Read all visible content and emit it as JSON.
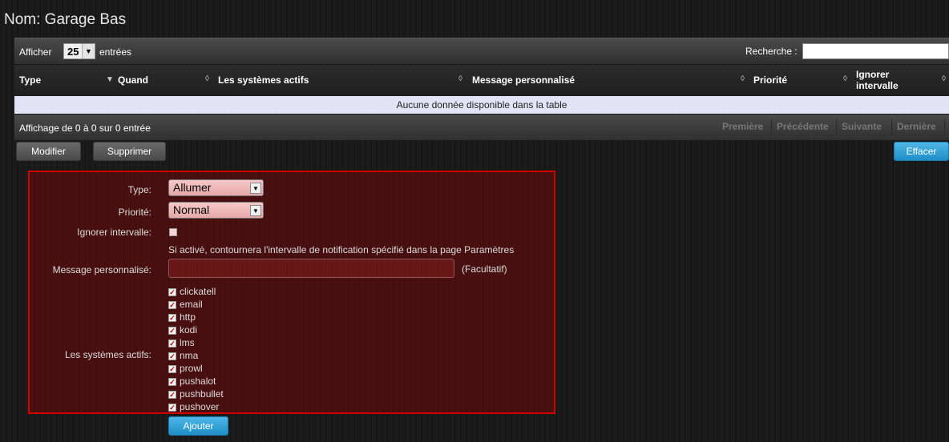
{
  "page": {
    "title": "Nom: Garage Bas"
  },
  "table_controls": {
    "show_label": "Afficher",
    "length_value": "25",
    "entries_label": "entrées",
    "search_label": "Recherche :",
    "search_value": ""
  },
  "table": {
    "columns": [
      "Type",
      "Quand",
      "Les systèmes actifs",
      "Message personnalisé",
      "Priorité",
      "Ignorer intervalle"
    ],
    "empty_message": "Aucune donnée disponible dans la table"
  },
  "info": {
    "text": "Affichage de 0 à 0 sur 0 entrée"
  },
  "pagination": [
    "Première",
    "Précédente",
    "Suivante",
    "Dernière"
  ],
  "actions": {
    "modify": "Modifier",
    "delete": "Supprimer",
    "clear": "Effacer"
  },
  "form": {
    "type_label": "Type:",
    "type_value": "Allumer",
    "priority_label": "Priorité:",
    "priority_value": "Normal",
    "ignore_label": "Ignorer intervalle:",
    "ignore_checked": false,
    "ignore_help": "Si activé, contournera l'intervalle de notification spécifié dans la page Paramètres",
    "message_label": "Message personnalisé:",
    "message_value": "",
    "message_hint": "(Facultatif)",
    "systems_label": "Les systèmes actifs:",
    "systems": [
      {
        "name": "clickatell",
        "checked": true
      },
      {
        "name": "email",
        "checked": true
      },
      {
        "name": "http",
        "checked": true
      },
      {
        "name": "kodi",
        "checked": true
      },
      {
        "name": "lms",
        "checked": true
      },
      {
        "name": "nma",
        "checked": true
      },
      {
        "name": "prowl",
        "checked": true
      },
      {
        "name": "pushalot",
        "checked": true
      },
      {
        "name": "pushbullet",
        "checked": true
      },
      {
        "name": "pushover",
        "checked": true
      }
    ],
    "add_button": "Ajouter"
  },
  "colors": {
    "form_border": "#d40000",
    "primary_button": "#2a9ad6",
    "empty_row": "#e3e3f6"
  }
}
